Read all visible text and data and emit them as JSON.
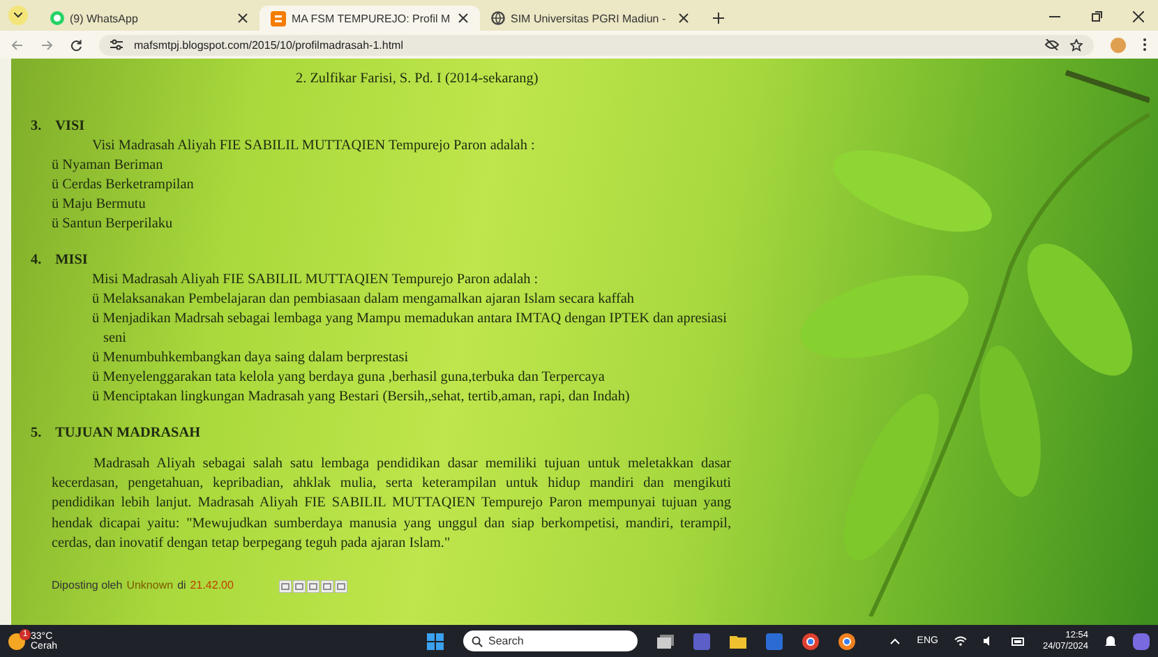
{
  "browser": {
    "tabs": [
      {
        "title": "(9) WhatsApp",
        "kind": "whatsapp",
        "selected": false
      },
      {
        "title": "MA FSM TEMPUREJO: Profil M",
        "kind": "blogger",
        "selected": true
      },
      {
        "title": "SIM Universitas PGRI Madiun -",
        "kind": "globe",
        "selected": false
      }
    ],
    "url": "mafsmtpj.blogspot.com/2015/10/profilmadrasah-1.html"
  },
  "page": {
    "top_line": "2. Zulfikar Farisi, S. Pd. I (2014-sekarang)",
    "sections": [
      {
        "number": "3.",
        "heading": "VISI",
        "intro": "Visi Madrasah Aliyah FIE SABILIL MUTTAQIEN Tempurejo Paron  adalah :",
        "indented": false,
        "items": [
          "ü Nyaman Beriman",
          "ü Cerdas Berketrampilan",
          "ü Maju Bermutu",
          "ü Santun Berperilaku"
        ]
      },
      {
        "number": "4.",
        "heading": "MISI",
        "intro": "Misi Madrasah Aliyah FIE SABILIL MUTTAQIEN Tempurejo Paron  adalah :",
        "indented": true,
        "items": [
          "ü Melaksanakan Pembelajaran dan pembiasaan dalam mengamalkan ajaran Islam secara kaffah",
          "ü  Menjadikan Madrsah sebagai lembaga yang Mampu memadukan antara IMTAQ dengan IPTEK  dan apresiasi seni",
          "ü Menumbuhkembangkan daya saing dalam berprestasi",
          "ü Menyelenggarakan tata kelola yang berdaya guna ,berhasil guna,terbuka dan Terpercaya",
          "ü Menciptakan lingkungan Madrasah yang Bestari (Bersih,,sehat, tertib,aman, rapi, dan Indah)"
        ]
      },
      {
        "number": "5.",
        "heading": "TUJUAN MADRASAH",
        "paragraph": "Madrasah Aliyah sebagai salah satu lembaga pendidikan dasar memiliki tujuan untuk meletakkan dasar kecerdasan, pengetahuan, kepribadian, ahklak mulia, serta keterampilan untuk hidup mandiri dan mengikuti pendidikan lebih lanjut. Madrasah Aliyah FIE SABILIL MUTTAQIEN Tempurejo Paron mempunyai tujuan yang hendak dicapai yaitu: \"Mewujudkan sumberdaya manusia yang unggul dan siap berkompetisi, mandiri, terampil, cerdas, dan inovatif dengan tetap berpegang teguh pada ajaran Islam.\""
      }
    ],
    "footer": {
      "label": "Diposting oleh",
      "author": "Unknown",
      "at": "di",
      "time": "21.42.00"
    }
  },
  "taskbar": {
    "temperature": "33°C",
    "condition": "Cerah",
    "badge": "1",
    "search_placeholder": "Search",
    "language": "ENG",
    "time": "12:54",
    "date": "24/07/2024"
  }
}
